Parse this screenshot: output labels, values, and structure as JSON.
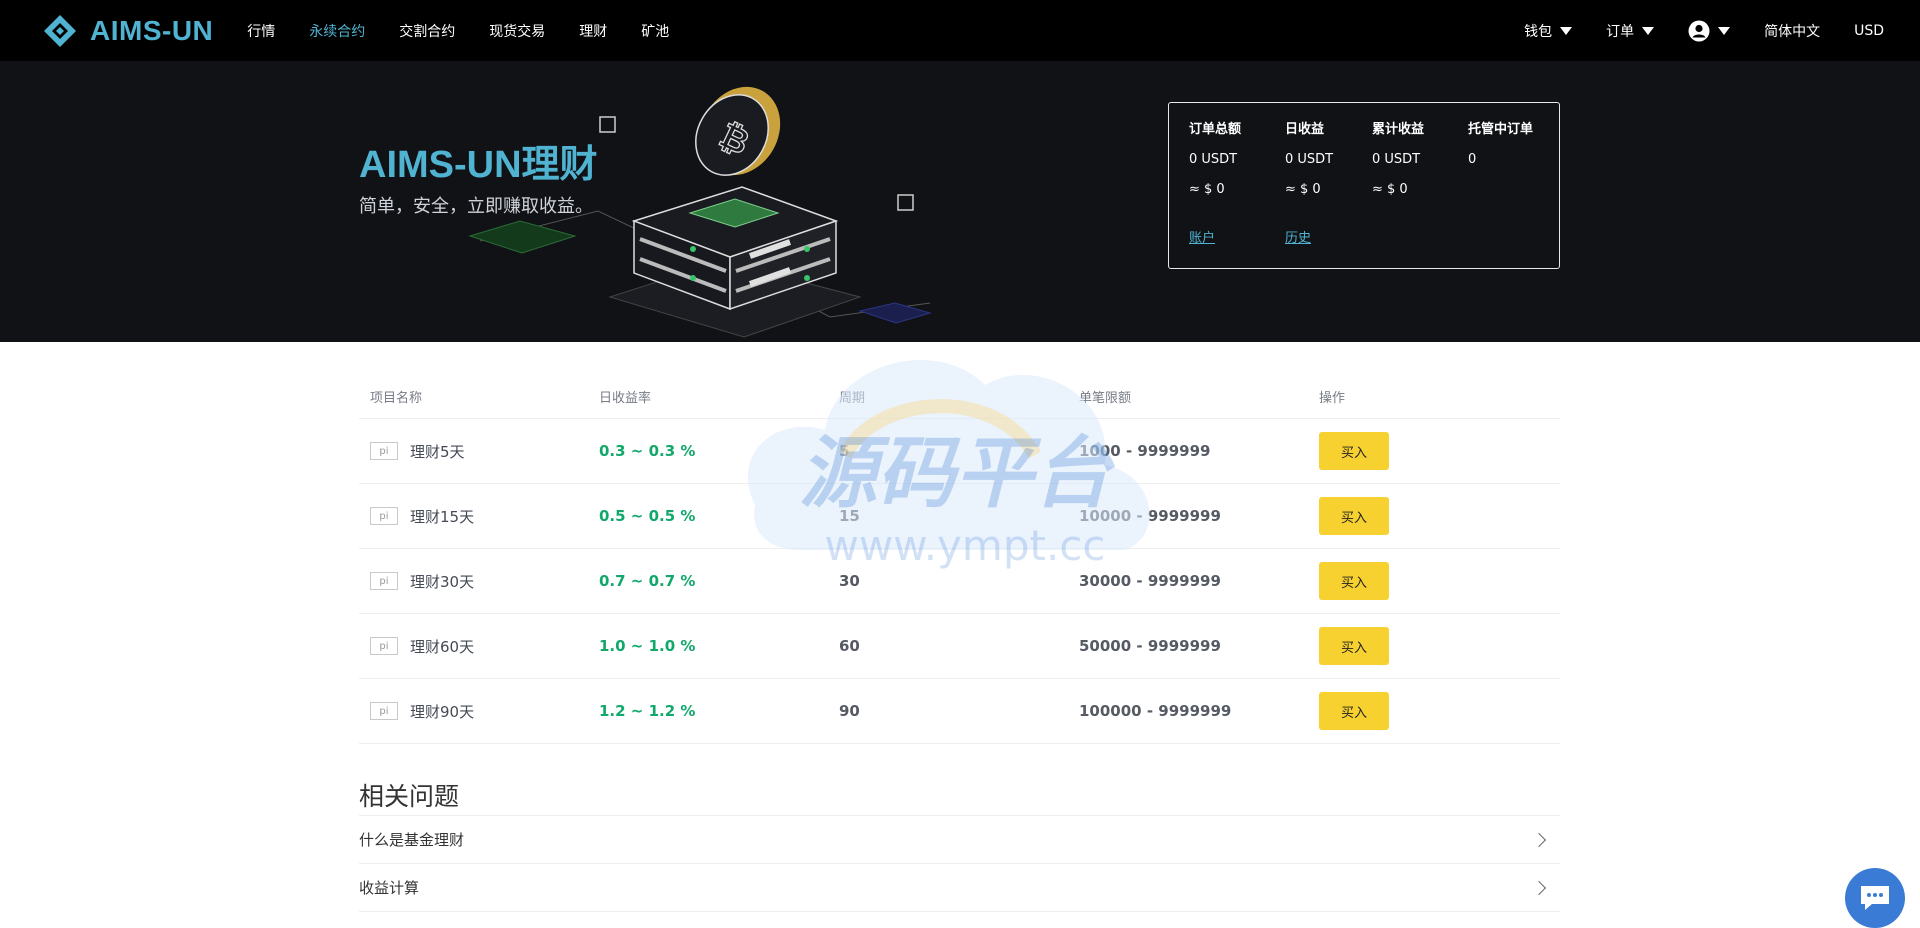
{
  "brand": {
    "name": "AIMS-UN"
  },
  "nav": {
    "items": [
      {
        "label": "行情"
      },
      {
        "label": "永续合约",
        "active": true
      },
      {
        "label": "交割合约"
      },
      {
        "label": "现货交易"
      },
      {
        "label": "理财"
      },
      {
        "label": "矿池"
      }
    ],
    "right": {
      "wallet": "钱包",
      "orders": "订单",
      "language": "简体中文",
      "currency": "USD"
    }
  },
  "hero": {
    "title": "AIMS-UN理财",
    "subtitle": "简单，安全，立即赚取收益。"
  },
  "stats": {
    "columns": [
      {
        "label": "订单总额",
        "value": "0 USDT",
        "approx": "≈ $ 0"
      },
      {
        "label": "日收益",
        "value": "0 USDT",
        "approx": "≈ $ 0"
      },
      {
        "label": "累计收益",
        "value": "0 USDT",
        "approx": "≈ $ 0"
      },
      {
        "label": "托管中订单",
        "value": "0",
        "approx": ""
      }
    ],
    "links": {
      "account": "账户",
      "history": "历史"
    }
  },
  "table": {
    "headers": [
      "项目名称",
      "日收益率",
      "周期",
      "单笔限额",
      "操作"
    ],
    "thumb_alt": "pi",
    "buy_label": "买入",
    "rows": [
      {
        "name": "理财5天",
        "rate": "0.3 ~ 0.3 %",
        "period": "5",
        "limit": "1000 - 9999999"
      },
      {
        "name": "理财15天",
        "rate": "0.5 ~ 0.5 %",
        "period": "15",
        "limit": "10000 - 9999999"
      },
      {
        "name": "理财30天",
        "rate": "0.7 ~ 0.7 %",
        "period": "30",
        "limit": "30000 - 9999999"
      },
      {
        "name": "理财60天",
        "rate": "1.0 ~ 1.0 %",
        "period": "60",
        "limit": "50000 - 9999999"
      },
      {
        "name": "理财90天",
        "rate": "1.2 ~ 1.2 %",
        "period": "90",
        "limit": "100000 - 9999999"
      }
    ]
  },
  "faq": {
    "title": "相关问题",
    "items": [
      "什么是基金理财",
      "收益计算"
    ]
  },
  "watermark": {
    "title": "源码平台",
    "url": "www.ympt.cc"
  },
  "colors": {
    "accent": "#4fb3d1",
    "rate_green": "#12a86b",
    "buy_yellow": "#f7d130",
    "nav_bg": "#000000",
    "hero_bg": "#111216"
  }
}
